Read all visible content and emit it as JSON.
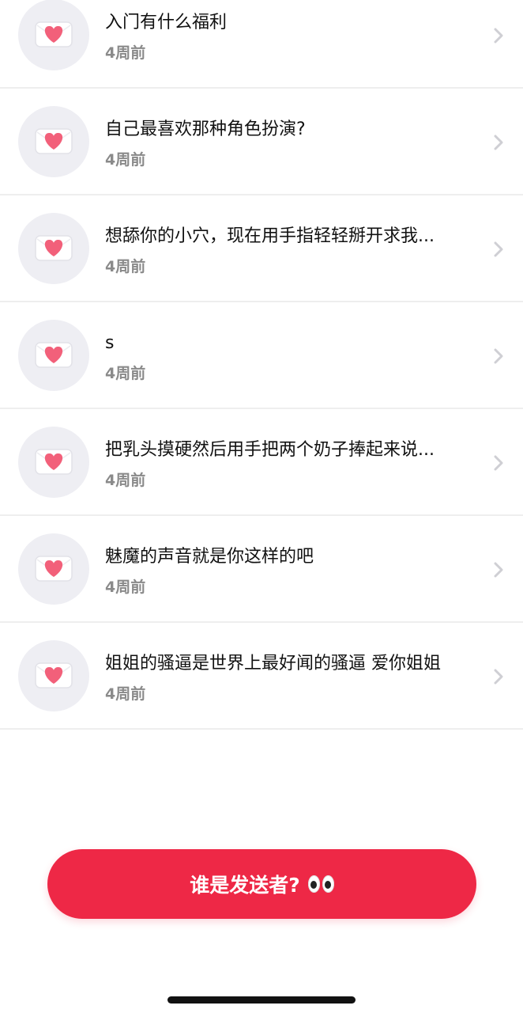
{
  "messages": [
    {
      "text": "入门有什么福利",
      "time": "4周前"
    },
    {
      "text": "自己最喜欢那种角色扮演?",
      "time": "4周前"
    },
    {
      "text": "想舔你的小穴，现在用手指轻轻掰开求我...",
      "time": "4周前"
    },
    {
      "text": "s",
      "time": "4周前"
    },
    {
      "text": "把乳头摸硬然后用手把两个奶子捧起来说...",
      "time": "4周前"
    },
    {
      "text": "魅魔的声音就是你这样的吧",
      "time": "4周前"
    },
    {
      "text": "姐姐的骚逼是世界上最好闻的骚逼 爱你姐姐",
      "time": "4周前"
    }
  ],
  "icons": {
    "avatar": "envelope-heart-icon",
    "row_action": "chevron-right-icon",
    "cta": "eyes-icon"
  },
  "cta": {
    "label": "谁是发送者?"
  },
  "colors": {
    "accent": "#ee2846",
    "heart": "#f2607a",
    "avatar_bg": "#eeeef3"
  }
}
